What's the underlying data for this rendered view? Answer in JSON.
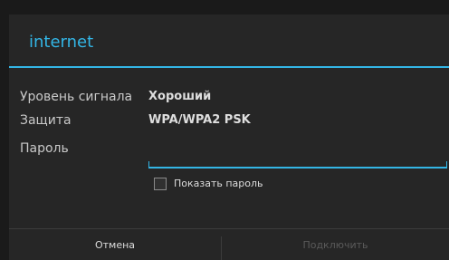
{
  "dialog": {
    "title": "internet",
    "accent_color": "#33b5e5",
    "background_color": "#262626"
  },
  "rows": {
    "signal": {
      "label": "Уровень сигнала",
      "value": "Хороший"
    },
    "security": {
      "label": "Защита",
      "value": "WPA/WPA2 PSK"
    },
    "password": {
      "label": "Пароль",
      "value": "",
      "placeholder": ""
    }
  },
  "show_password": {
    "label": "Показать пароль",
    "checked": false
  },
  "buttons": {
    "cancel_label": "Отмена",
    "connect_label": "Подключить",
    "connect_enabled": false
  }
}
